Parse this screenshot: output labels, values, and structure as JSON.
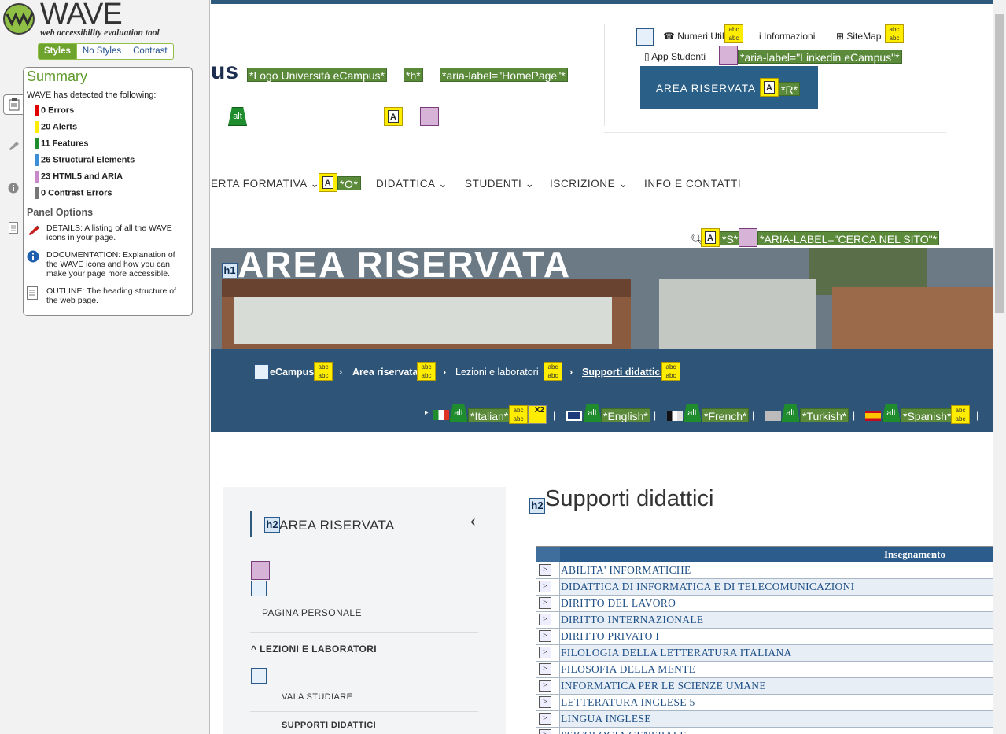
{
  "wave": {
    "title": "WAVE",
    "subtitle": "web accessibility evaluation tool",
    "tabs": [
      "Styles",
      "No Styles",
      "Contrast"
    ],
    "summary_title": "Summary",
    "intro": "WAVE has detected the following:",
    "stats": [
      {
        "label": "0 Errors",
        "color": "#e00000"
      },
      {
        "label": "20 Alerts",
        "color": "#ffed00"
      },
      {
        "label": "11 Features",
        "color": "#1f8c2e"
      },
      {
        "label": "26 Structural Elements",
        "color": "#3b8fd9"
      },
      {
        "label": "23 HTML5 and ARIA",
        "color": "#c98ac9"
      },
      {
        "label": "0 Contrast Errors",
        "color": "#777777"
      }
    ],
    "panel_options_title": "Panel Options",
    "panel_options": [
      "DETAILS: A listing of all the WAVE icons in your page.",
      "DOCUMENTATION: Explanation of the WAVE icons and how you can make your page more accessible.",
      "OUTLINE: The heading structure of the web page."
    ]
  },
  "header": {
    "logo_fragment": "us",
    "util_links": [
      "Numeri Utili",
      "Informazioni",
      "SiteMap",
      "App Studenti"
    ],
    "area_button": "AREA RISERVATA",
    "labels": {
      "logo": "*Logo Università eCampus*",
      "h": "*h*",
      "homepage": "*aria-label=\"HomePage\"*",
      "linkedin": "*aria-label=\"Linkedin eCampus\"*",
      "r": "*R*",
      "o": "*O*",
      "s": "*S*",
      "cerca": "*ARIA-LABEL=\"CERCA NEL SITO\"*"
    }
  },
  "nav": [
    "ERTA FORMATIVA",
    "DIDATTICA",
    "STUDENTI",
    "ISCRIZIONE",
    "INFO E CONTATTI"
  ],
  "hero": {
    "title": "AREA RISERVATA",
    "breadcrumb": [
      "eCampus",
      "Area riservata",
      "Lezioni e laboratori",
      "Supporti didattici"
    ],
    "languages": [
      "*Italian*",
      "*English*",
      "*French*",
      "*Turkish*",
      "*Spanish*"
    ],
    "x2": "X2"
  },
  "sidebar": {
    "title": "AREA RISERVATA",
    "items": [
      "PAGINA PERSONALE",
      "LEZIONI E LABORATORI",
      "VAI A STUDIARE",
      "SUPPORTI DIDATTICI"
    ]
  },
  "main": {
    "title": "Supporti didattici",
    "table_header": "Insegnamento",
    "rows": [
      "ABILITA' INFORMATICHE",
      "DIDATTICA DI INFORMATICA E DI TELECOMUNICAZIONI",
      "DIRITTO DEL LAVORO",
      "DIRITTO INTERNAZIONALE",
      "DIRITTO PRIVATO I",
      "FILOLOGIA DELLA LETTERATURA ITALIANA",
      "FILOSOFIA DELLA MENTE",
      "INFORMATICA PER LE SCIENZE UMANE",
      "LETTERATURA INGLESE 5",
      "LINGUA INGLESE",
      "PSICOLOGIA GENERALE"
    ],
    "row_button": ">"
  }
}
